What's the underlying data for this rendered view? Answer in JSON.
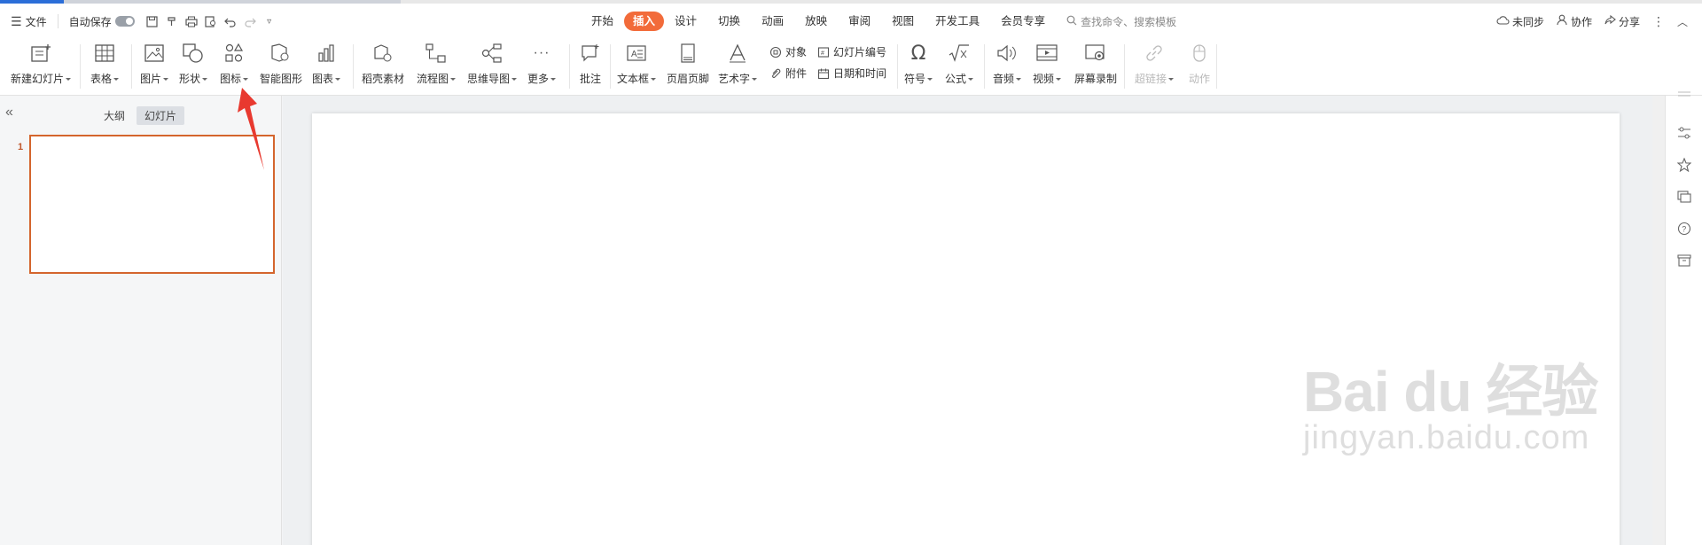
{
  "menu": {
    "file": "文件",
    "autosave": "自动保存"
  },
  "tabs": [
    "开始",
    "插入",
    "设计",
    "切换",
    "动画",
    "放映",
    "审阅",
    "视图",
    "开发工具",
    "会员专享"
  ],
  "active_tab": "插入",
  "search": {
    "placeholder": "查找命令、搜索模板"
  },
  "right": {
    "sync": "未同步",
    "collab": "协作",
    "share": "分享"
  },
  "ribbon": {
    "new_slide": "新建幻灯片",
    "table": "表格",
    "picture": "图片",
    "shape": "形状",
    "icon": "图标",
    "smart_graphic": "智能图形",
    "chart": "图表",
    "material": "稻壳素材",
    "flowchart": "流程图",
    "mindmap": "思维导图",
    "more": "更多",
    "comment": "批注",
    "textbox": "文本框",
    "header_footer": "页眉页脚",
    "wordart": "艺术字",
    "object": "对象",
    "attachment": "附件",
    "slide_number": "幻灯片编号",
    "date_time": "日期和时间",
    "symbol": "符号",
    "formula": "公式",
    "audio": "音频",
    "video": "视频",
    "screen_record": "屏幕录制",
    "hyperlink": "超链接",
    "action": "动作"
  },
  "panel": {
    "collapse": "«",
    "tab_outline": "大纲",
    "tab_slides": "幻灯片",
    "slide_number": "1"
  },
  "watermark": {
    "big": "Bai du 经验",
    "small": "jingyan.baidu.com"
  },
  "colors": {
    "accent": "#f26b3a",
    "selection": "#d4652d",
    "arrow": "#e8392f"
  }
}
